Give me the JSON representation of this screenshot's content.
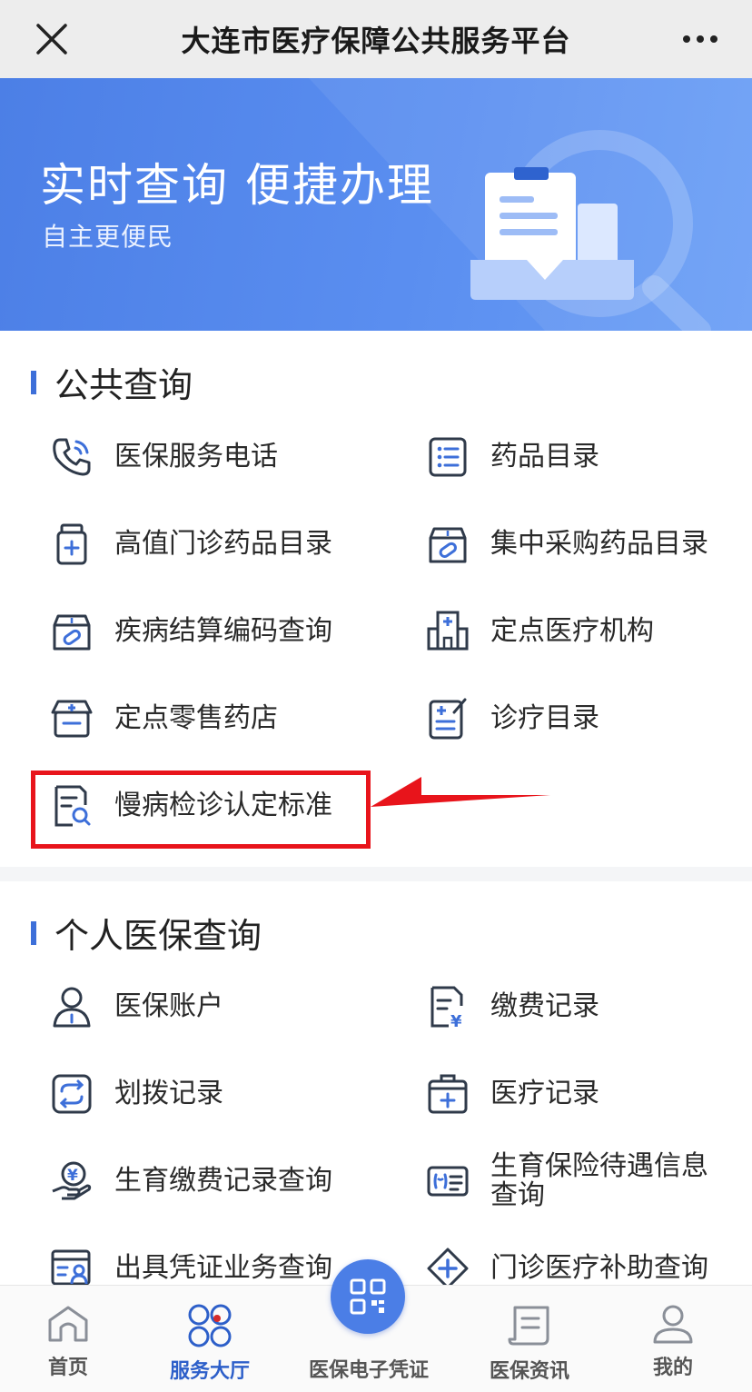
{
  "window": {
    "title": "大连市医疗保障公共服务平台",
    "close_icon": "close-icon",
    "more_icon": "more-icon"
  },
  "banner": {
    "headline": "实时查询 便捷办理",
    "subline": "自主更便民",
    "illustration": "document-search-illustration"
  },
  "public_query": {
    "title": "公共查询",
    "items": [
      {
        "label": "医保服务电话",
        "icon": "phone-icon"
      },
      {
        "label": "药品目录",
        "icon": "list-icon"
      },
      {
        "label": "高值门诊药品目录",
        "icon": "medicine-bottle-icon"
      },
      {
        "label": "集中采购药品目录",
        "icon": "pill-box-icon"
      },
      {
        "label": "疾病结算编码查询",
        "icon": "medicine-box-icon"
      },
      {
        "label": "定点医疗机构",
        "icon": "hospital-icon"
      },
      {
        "label": "定点零售药店",
        "icon": "pharmacy-icon"
      },
      {
        "label": "诊疗目录",
        "icon": "edit-document-icon"
      },
      {
        "label": "慢病检诊认定标准",
        "icon": "document-search-icon"
      }
    ]
  },
  "personal_query": {
    "title": "个人医保查询",
    "items": [
      {
        "label": "医保账户",
        "icon": "person-icon"
      },
      {
        "label": "缴费记录",
        "icon": "payment-document-icon"
      },
      {
        "label": "划拨记录",
        "icon": "transfer-icon"
      },
      {
        "label": "医疗记录",
        "icon": "medical-kit-icon"
      },
      {
        "label": "生育缴费记录查询",
        "icon": "hand-coin-icon"
      },
      {
        "label": "生育保险待遇信息查询",
        "icon": "id-card-icon"
      },
      {
        "label": "出具凭证业务查询",
        "icon": "certificate-icon"
      },
      {
        "label": "门诊医疗补助查询",
        "icon": "diamond-plus-icon"
      }
    ]
  },
  "annotation": {
    "highlight_color": "#e8141b"
  },
  "bottom_nav": {
    "items": [
      {
        "label": "首页",
        "icon": "home-icon"
      },
      {
        "label": "服务大厅",
        "icon": "service-hall-icon",
        "active": true
      },
      {
        "label": "医保电子凭证",
        "icon": "qr-code-icon"
      },
      {
        "label": "医保资讯",
        "icon": "news-scroll-icon"
      },
      {
        "label": "我的",
        "icon": "user-icon"
      }
    ]
  },
  "colors": {
    "accent": "#3d6fd9",
    "banner": "#5a8ef0",
    "active_nav": "#2d5fc9"
  }
}
